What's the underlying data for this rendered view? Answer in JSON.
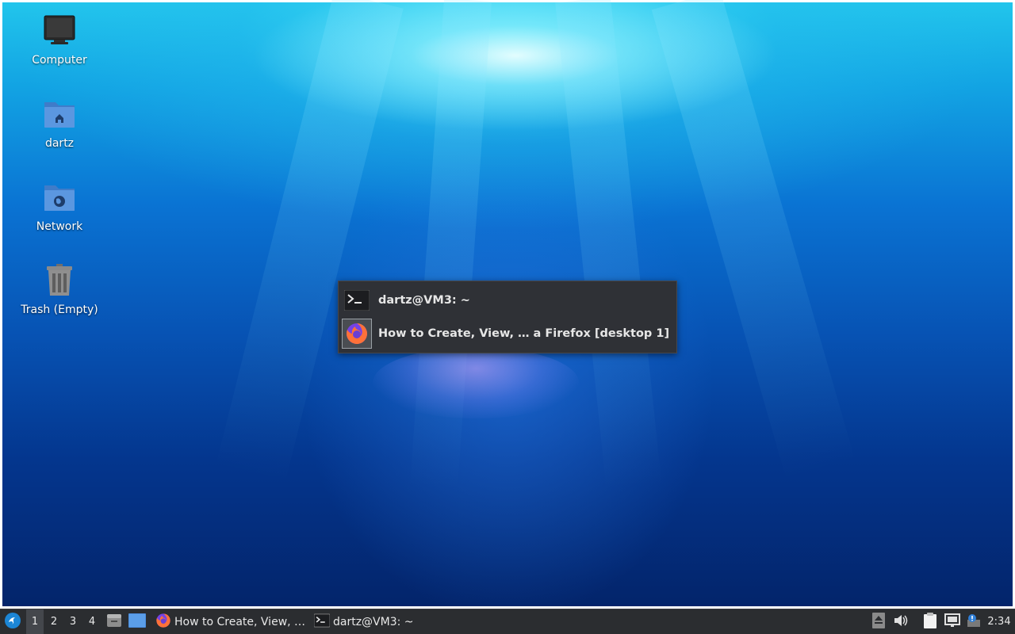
{
  "desktop": {
    "icons": [
      {
        "label": "Computer",
        "icon": "monitor-icon"
      },
      {
        "label": "dartz",
        "icon": "home-folder-icon"
      },
      {
        "label": "Network",
        "icon": "network-folder-icon"
      },
      {
        "label": "Trash (Empty)",
        "icon": "trash-icon"
      }
    ]
  },
  "switcher": {
    "items": [
      {
        "label": "dartz@VM3: ~",
        "icon": "terminal-icon"
      },
      {
        "label": "How to Create, View, … a Firefox [desktop 1]",
        "icon": "firefox-icon"
      }
    ]
  },
  "taskbar": {
    "start_icon": "lxqt-menu-icon",
    "workspaces": [
      "1",
      "2",
      "3",
      "4"
    ],
    "active_workspace": "1",
    "quicklaunch": [
      {
        "icon": "file-manager-icon"
      },
      {
        "icon": "show-desktop-icon"
      }
    ],
    "tasks": [
      {
        "label": "How to Create, View, …",
        "icon": "firefox-icon"
      },
      {
        "label": "dartz@VM3: ~",
        "icon": "terminal-icon"
      }
    ],
    "tray": [
      {
        "icon": "eject-icon"
      },
      {
        "icon": "volume-icon"
      },
      {
        "icon": "clipboard-icon"
      },
      {
        "icon": "network-monitor-icon"
      },
      {
        "icon": "notification-icon"
      }
    ],
    "clock": "2:34"
  },
  "colors": {
    "taskbar_bg": "#2b2d30",
    "switcher_bg": "#2f3136",
    "folder_blue": "#5b97e0",
    "firefox_orange": "#ff7139",
    "firefox_purple": "#7542e5"
  }
}
